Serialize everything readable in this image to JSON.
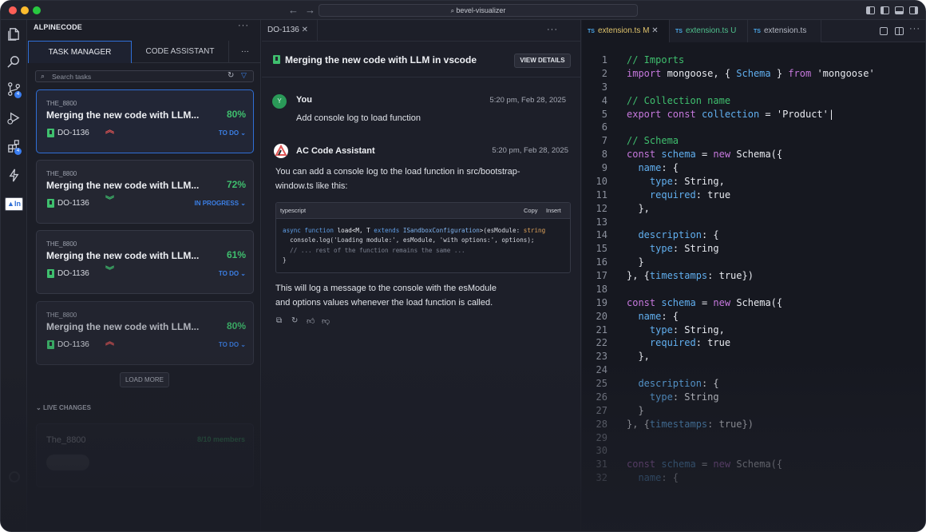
{
  "titlebar": {
    "search": "bevel-visualizer"
  },
  "sidebar": {
    "title": "ALPINECODE",
    "tabs": [
      "TASK MANAGER",
      "CODE ASSISTANT"
    ],
    "search_placeholder": "Search tasks",
    "activity_badges": [
      "4",
      "4"
    ],
    "cards": [
      {
        "user": "THE_8800",
        "title": "Merging the new code with LLM...",
        "percent": "80%",
        "id": "DO-1136",
        "status": "TO DO",
        "priority": "high"
      },
      {
        "user": "THE_8800",
        "title": "Merging the new code with LLM...",
        "percent": "72%",
        "id": "DO-1136",
        "status": "IN PROGRESS",
        "priority": "low"
      },
      {
        "user": "THE_8800",
        "title": "Merging the new code with LLM...",
        "percent": "61%",
        "id": "DO-1136",
        "status": "TO DO",
        "priority": "low"
      },
      {
        "user": "THE_8800",
        "title": "Merging the new code with LLM...",
        "percent": "80%",
        "id": "DO-1136",
        "status": "TO DO",
        "priority": "high"
      }
    ],
    "load_more": "LOAD MORE",
    "live_changes": "LIVE CHANGES",
    "live_card": {
      "name": "The_8800",
      "members": "8/10 members"
    }
  },
  "chat": {
    "tab": "DO-1136",
    "title": "Merging the new code with LLM in vscode",
    "view_details": "VIEW DETAILS",
    "messages": [
      {
        "avatar": "Y",
        "name": "You",
        "time": "5:20 pm, Feb 28, 2025",
        "text": "Add console log to load function"
      },
      {
        "name": "AC Code Assistant",
        "time": "5:20 pm, Feb 28, 2025",
        "text1": "You can add a console log to the load function in src/bootstrap-",
        "text2": "window.ts like this:",
        "text3": "This will log a message to the console with the esModule",
        "text4": "and options values whenever the load function is called."
      }
    ],
    "code_lang": "typescript",
    "copy": "Copy",
    "insert": "Insert"
  },
  "editor": {
    "tabs": [
      {
        "name": "extension.ts",
        "flag": "M"
      },
      {
        "name": "extension.ts",
        "flag": "U"
      },
      {
        "name": "extension.ts",
        "flag": ""
      }
    ]
  },
  "colors": {
    "accent": "#2f6fd6",
    "green": "#3fbf6e",
    "red": "#e05555",
    "keyword": "#c678dd",
    "comment": "#3fbf6e"
  }
}
